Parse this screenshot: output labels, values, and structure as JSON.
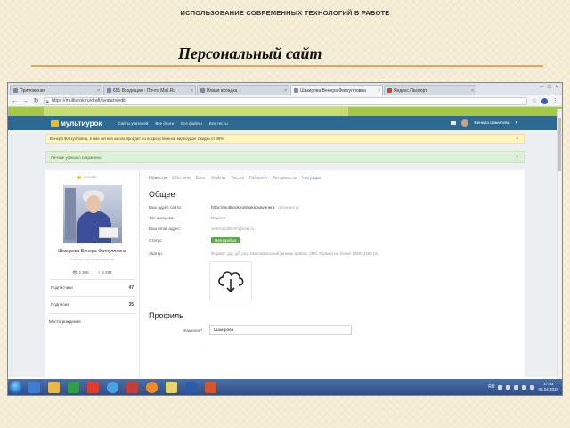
{
  "slide": {
    "header": "ИСПОЛЬЗОВАНИЕ СОВРЕМЕННЫХ ТЕХНОЛОГИЙ В РАБОТЕ",
    "title": "Персональный сайт",
    "rule_color": "#e1a760"
  },
  "browser": {
    "tabs": [
      {
        "label": "Приложения",
        "active": false
      },
      {
        "label": "651 Входящие - Почта Mail.Ru",
        "active": false
      },
      {
        "label": "Новая вкладка",
        "active": false
      },
      {
        "label": "Шакирова Венера Фатхулловна",
        "active": true
      },
      {
        "label": "Яндекс.Паспорт",
        "active": false
      }
    ],
    "url": "https://multiurok.ru/draft/avatars/edit/"
  },
  "site": {
    "logo": "мультиурок",
    "nav": [
      "Сайты учителей",
      "Все блоги",
      "Все файлы",
      "Все тесты"
    ],
    "user_name": "Венера Шакирова",
    "notice": "Венера Фатхулловна, в мае летняя школа пройдет по посредственной видеоурок! Скидки от 40%!",
    "success": "Личные успешно сохранены",
    "accent": "#2d6a91"
  },
  "profile": {
    "online": "онлайн",
    "name": "Шакирова Венера Фатхулловна",
    "role": "Учитель начальных классов",
    "views": "2 306",
    "rating": "5 293",
    "subscribers_label": "Подписчики",
    "subscribers": "47",
    "subscriptions_label": "Подписки",
    "subscriptions": "35",
    "workplace_label": "Место рождения"
  },
  "main": {
    "tabs": [
      "Новости",
      "Обо мне",
      "Блог",
      "Файлы",
      "Тесты",
      "Галерея",
      "Активность",
      "Награды"
    ],
    "general_title": "Общее",
    "site_label": "Ваш адрес сайта:",
    "site_value": "https://multiurok.ru/shakirovavenera",
    "site_note": "(Изменить)",
    "account_label": "Тип аккаунта:",
    "account_value": "Педагог",
    "email_label": "Ваш email адрес:",
    "email_value": "venera1305-97@mail.ru",
    "status_label": "Статус:",
    "status_value": "Новоприбыв",
    "avatar_label": "Аватар",
    "avatar_note": "Формат: jpg, gif, png. Максимальный размер файла: 2Мб. Размер не более 1280×1280 px.",
    "profile_title": "Профиль",
    "surname_label": "Фамилия*",
    "surname_value": "Шакирова"
  },
  "taskbar": {
    "lang": "RU",
    "time": "17:03",
    "date": "08.04.2019"
  }
}
